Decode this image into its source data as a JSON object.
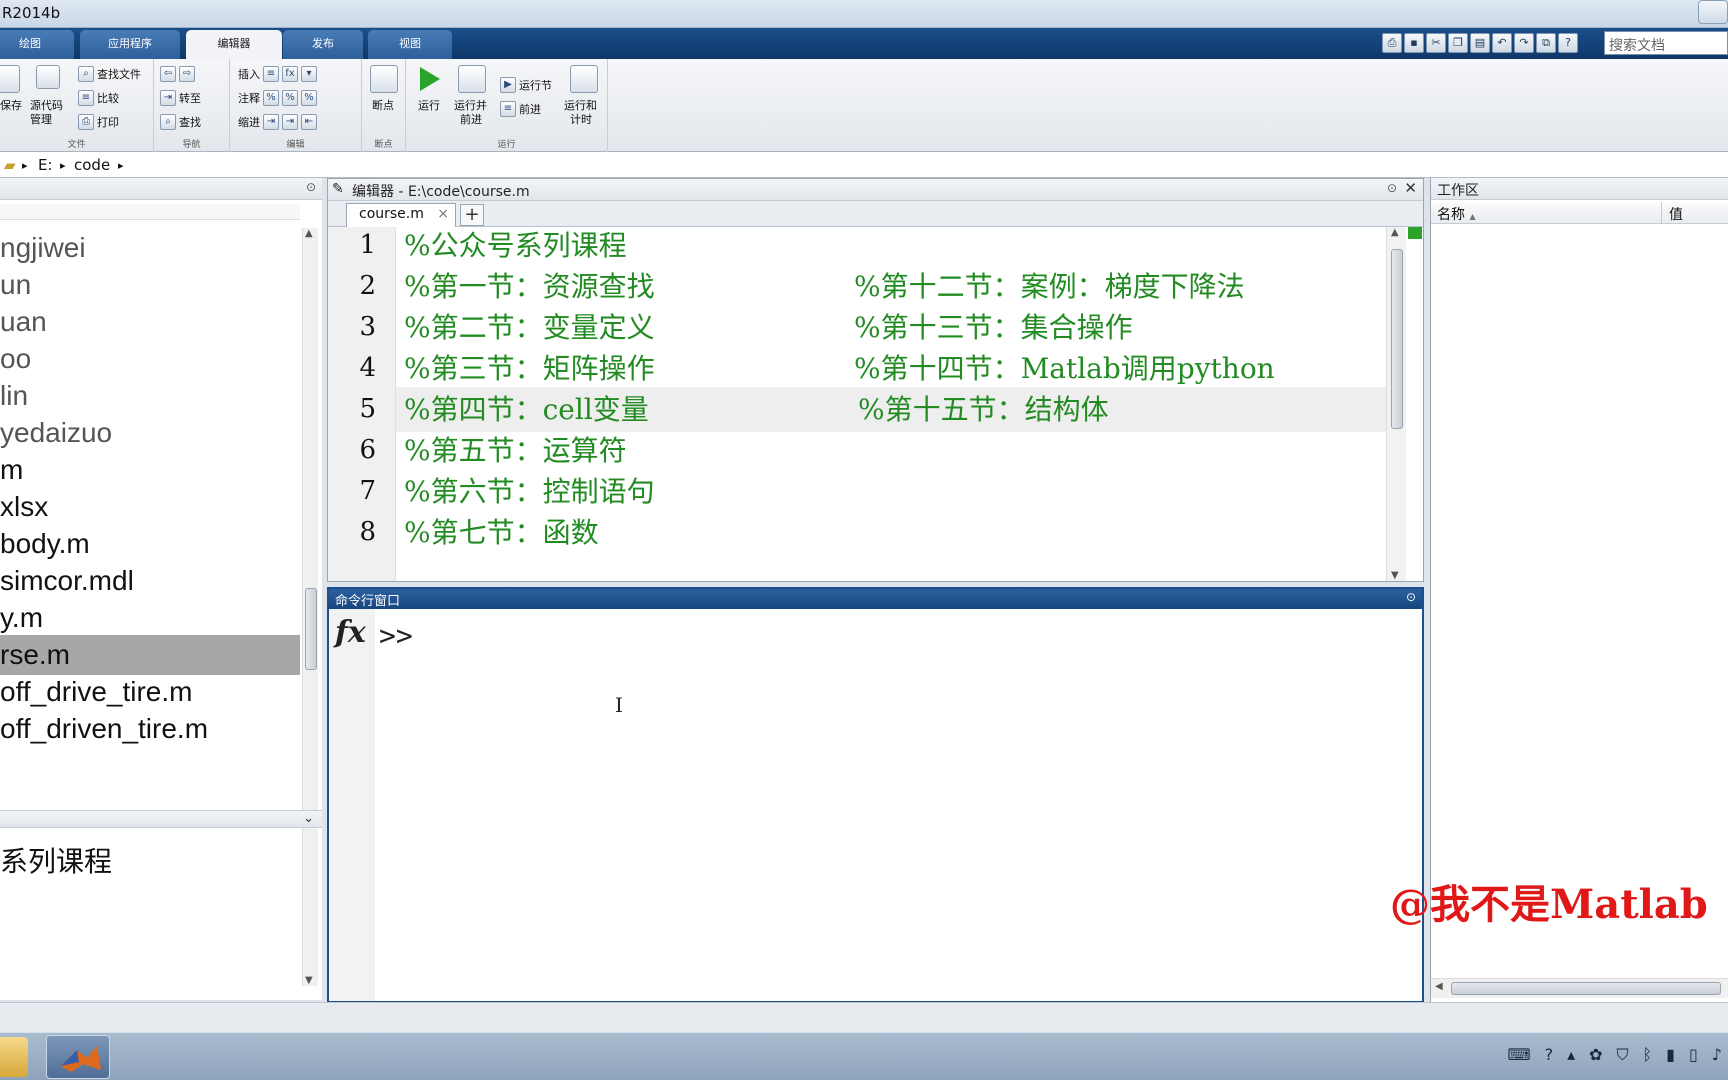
{
  "window": {
    "title": "R2014b"
  },
  "tabs": [
    {
      "label": "绘图",
      "active": false
    },
    {
      "label": "应用程序",
      "active": false
    },
    {
      "label": "编辑器",
      "active": true
    },
    {
      "label": "发布",
      "active": false
    },
    {
      "label": "视图",
      "active": false
    }
  ],
  "search": {
    "placeholder": "搜索文档"
  },
  "ribbon": {
    "file": {
      "group_label": "文件",
      "save": "保存",
      "source_control_1": "源代码",
      "source_control_2": "管理",
      "find_files": "查找文件",
      "compare": "比较",
      "print": "打印"
    },
    "navigate": {
      "group_label": "导航",
      "goto": "转至",
      "find": "查找"
    },
    "edit": {
      "group_label": "编辑",
      "insert": "插入",
      "comment": "注释",
      "indent": "缩进",
      "fx_symbol": "fx",
      "percent_symbol": "%"
    },
    "breakpoints": {
      "group_label": "断点",
      "label": "断点"
    },
    "run": {
      "group_label": "运行",
      "run": "运行",
      "run_advance_1": "运行并",
      "run_advance_2": "前进",
      "run_section": "运行节",
      "advance": "前进",
      "run_time_1": "运行和",
      "run_time_2": "计时"
    }
  },
  "address": {
    "drive": "E:",
    "folder": "code"
  },
  "files": [
    {
      "name": "ngjiwei",
      "dim": true,
      "selected": false
    },
    {
      "name": "un",
      "dim": true,
      "selected": false
    },
    {
      "name": "uan",
      "dim": true,
      "selected": false
    },
    {
      "name": "oo",
      "dim": true,
      "selected": false
    },
    {
      "name": "lin",
      "dim": true,
      "selected": false
    },
    {
      "name": "yedaizuo",
      "dim": true,
      "selected": false
    },
    {
      "name": "m",
      "dim": false,
      "selected": false
    },
    {
      "name": "xlsx",
      "dim": false,
      "selected": false
    },
    {
      "name": "body.m",
      "dim": false,
      "selected": false
    },
    {
      "name": "simcor.mdl",
      "dim": false,
      "selected": false
    },
    {
      "name": "y.m",
      "dim": false,
      "selected": false
    },
    {
      "name": "rse.m",
      "dim": false,
      "selected": true
    },
    {
      "name": "off_drive_tire.m",
      "dim": false,
      "selected": false
    },
    {
      "name": "off_driven_tire.m",
      "dim": false,
      "selected": false
    }
  ],
  "details": {
    "text": "系列课程"
  },
  "editor": {
    "header": "编辑器 - E:\\code\\course.m",
    "tab": "course.m",
    "tab_close": "×",
    "plus": "+",
    "lines": [
      {
        "num": "1",
        "left": "%公众号系列课程",
        "right": "",
        "highlight": false,
        "shift": false
      },
      {
        "num": "2",
        "left": "%第一节：资源查找",
        "right": "%第十二节：案例：梯度下降法",
        "highlight": false,
        "shift": false
      },
      {
        "num": "3",
        "left": "%第二节：变量定义",
        "right": "%第十三节：集合操作",
        "highlight": false,
        "shift": false
      },
      {
        "num": "4",
        "left": "%第三节：矩阵操作",
        "right": "%第十四节：Matlab调用python",
        "highlight": false,
        "shift": false
      },
      {
        "num": "5",
        "left": "%第四节：cell变量",
        "right": "%第十五节：结构体",
        "highlight": true,
        "shift": true
      },
      {
        "num": "6",
        "left": "%第五节：运算符",
        "right": "",
        "highlight": false,
        "shift": false
      },
      {
        "num": "7",
        "left": "%第六节：控制语句",
        "right": "",
        "highlight": false,
        "shift": false
      },
      {
        "num": "8",
        "left": "%第七节：函数",
        "right": "",
        "highlight": false,
        "shift": false
      }
    ]
  },
  "command_window": {
    "title": "命令行窗口",
    "fx": "fx",
    "prompt": ">>",
    "cursor": "I"
  },
  "workspace": {
    "title": "工作区",
    "col_name": "名称",
    "sort_arrow": "▲",
    "col_value": "值"
  },
  "watermark": "@我不是Matlab",
  "colors": {
    "comment_green": "#228b22",
    "selection_gray": "#a7a7a7",
    "watermark_red": "#e01818",
    "tab_blue": "#1b4f8c"
  }
}
